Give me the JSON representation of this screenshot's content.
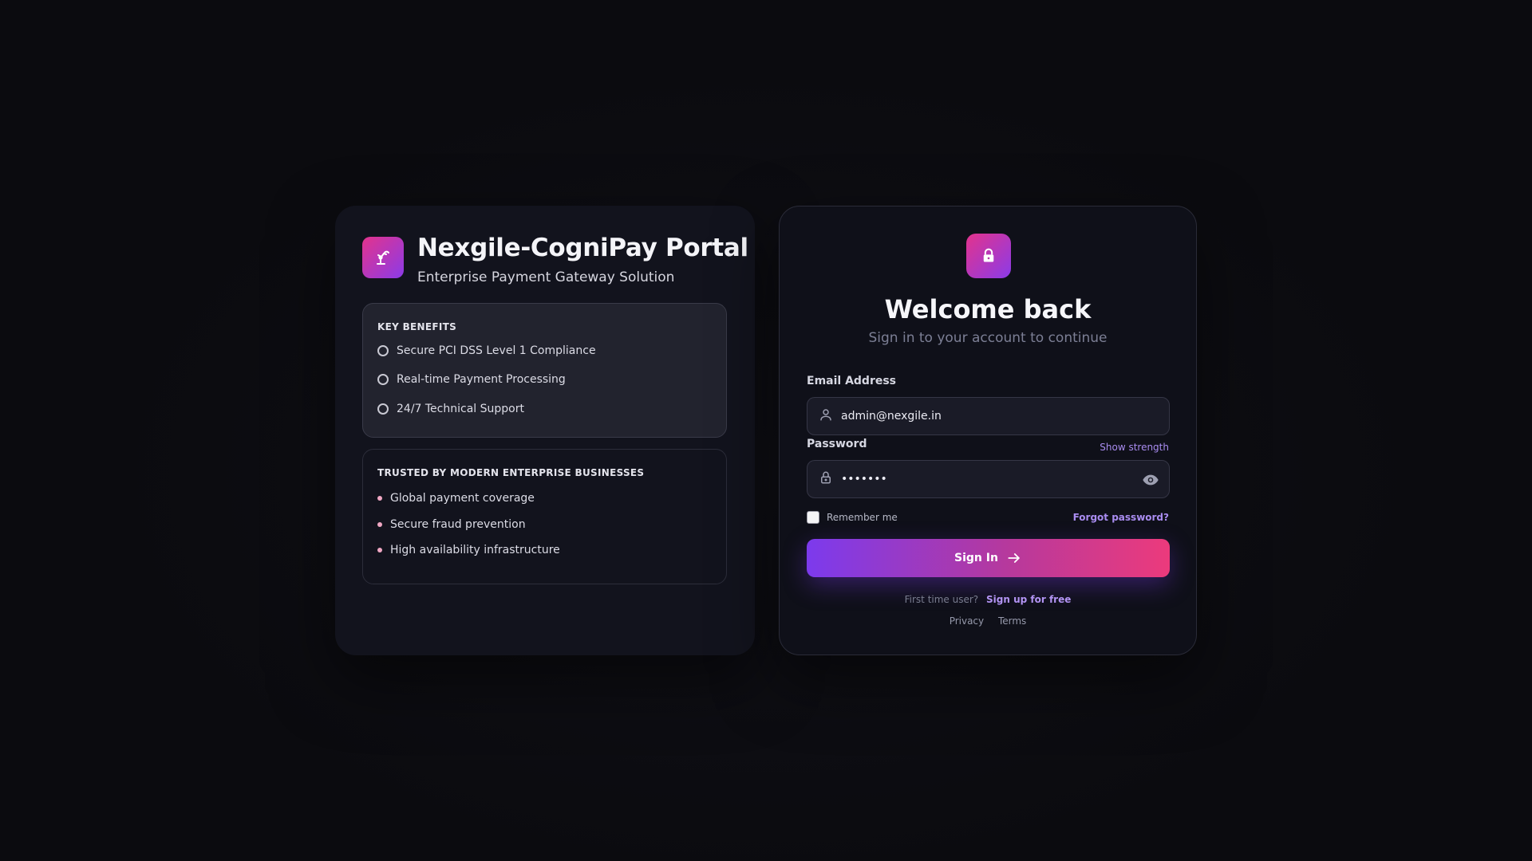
{
  "brand": {
    "title": "Nexgile-CogniPay Portal",
    "subtitle": "Enterprise Payment Gateway Solution",
    "logo_icon": "robot-arm-icon"
  },
  "benefits": {
    "heading": "KEY BENEFITS",
    "items": [
      "Secure PCI DSS Level 1 Compliance",
      "Real-time Payment Processing",
      "24/7 Technical Support"
    ]
  },
  "trusted": {
    "heading": "TRUSTED BY MODERN ENTERPRISE BUSINESSES",
    "items": [
      "Global payment coverage",
      "Secure fraud prevention",
      "High availability infrastructure"
    ]
  },
  "login": {
    "badge_icon": "lock-icon",
    "title": "Welcome back",
    "subtitle": "Sign in to your account to continue",
    "email_label": "Email Address",
    "email_value": "admin@nexgile.in",
    "password_label": "Password",
    "password_value": "•••••••",
    "show_strength": "Show strength",
    "remember_label": "Remember me",
    "forgot_label": "Forgot password?",
    "signin_label": "Sign In",
    "first_time": "First time user?",
    "signup_label": "Sign up for free",
    "privacy_label": "Privacy",
    "terms_label": "Terms"
  },
  "colors": {
    "background": "#0b0b0f",
    "card": "#12131d",
    "accent_pink": "#e3338c",
    "accent_purple": "#7c3aed",
    "link": "#a98cf0"
  }
}
